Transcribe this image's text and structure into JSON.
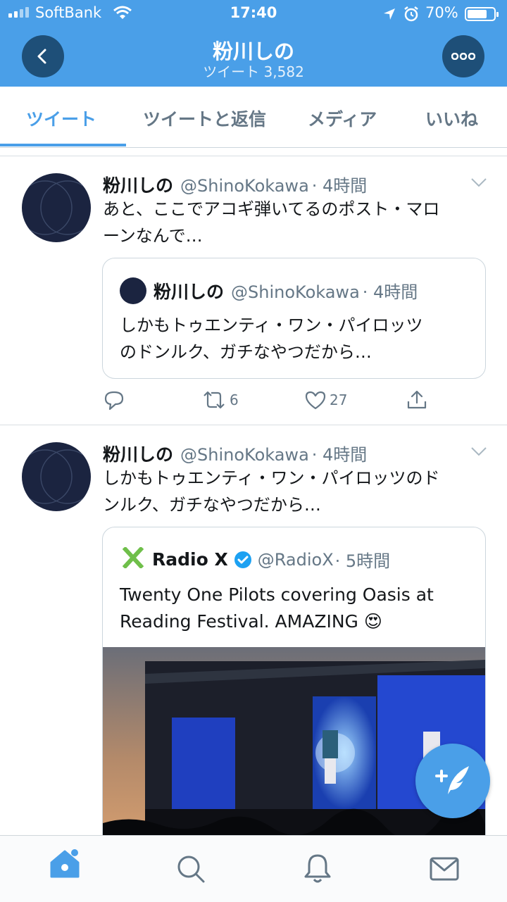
{
  "status_bar": {
    "carrier": "SoftBank",
    "time": "17:40",
    "battery": "70%"
  },
  "header": {
    "title": "粉川しの",
    "subtitle": "ツイート 3,582"
  },
  "tabs": [
    {
      "label": "ツイート",
      "active": true
    },
    {
      "label": "ツイートと返信"
    },
    {
      "label": "メディア"
    },
    {
      "label": "いいね"
    }
  ],
  "tweets": [
    {
      "name": "粉川しの",
      "handle": "@ShinoKokawa",
      "time": "· 4時間",
      "text_lines": [
        "あと、ここでアコギ弾いてるのポスト・マロ",
        "ーンなんで…"
      ],
      "quote": {
        "name": "粉川しの",
        "handle": "@ShinoKokawa",
        "time": "· 4時間",
        "text_lines": [
          "しかもトゥエンティ・ワン・パイロッツ",
          "のドンルク、ガチなやつだから…"
        ]
      },
      "retweets": "6",
      "likes": "27"
    },
    {
      "name": "粉川しの",
      "handle": "@ShinoKokawa",
      "time": "· 4時間",
      "text_lines": [
        "しかもトゥエンティ・ワン・パイロッツのド",
        "ンルク、ガチなやつだから…"
      ],
      "quote": {
        "name": "Radio X",
        "handle": "@RadioX",
        "time": "· 5時間",
        "text_lines": [
          "Twenty One Pilots covering Oasis at",
          "Reading Festival. AMAZING"
        ],
        "emoji": "😍"
      }
    }
  ],
  "colors": {
    "accent": "#4a9fe8",
    "header_button": "#1e4f78",
    "verified": "#1da1f2",
    "radiox_logo": "#6fbf4a"
  },
  "icons": [
    "back-arrow-icon",
    "more-dots-icon",
    "chevron-down-icon",
    "reply-icon",
    "retweet-icon",
    "like-icon",
    "share-icon",
    "verified-icon",
    "compose-icon",
    "home-icon",
    "search-icon",
    "notifications-icon",
    "messages-icon"
  ]
}
